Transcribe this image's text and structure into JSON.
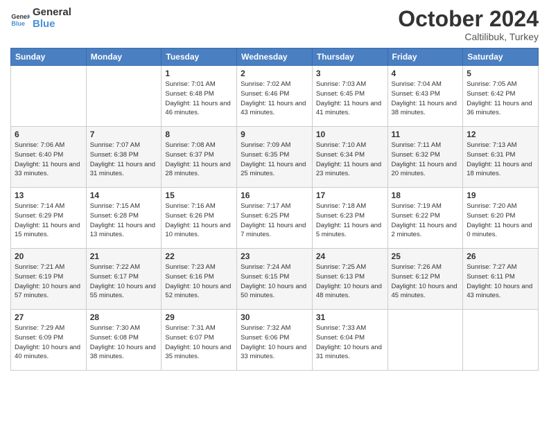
{
  "logo": {
    "line1": "General",
    "line2": "Blue"
  },
  "title": "October 2024",
  "location": "Caltilibuk, Turkey",
  "weekdays": [
    "Sunday",
    "Monday",
    "Tuesday",
    "Wednesday",
    "Thursday",
    "Friday",
    "Saturday"
  ],
  "weeks": [
    [
      {
        "day": "",
        "info": ""
      },
      {
        "day": "",
        "info": ""
      },
      {
        "day": "1",
        "info": "Sunrise: 7:01 AM\nSunset: 6:48 PM\nDaylight: 11 hours and 46 minutes."
      },
      {
        "day": "2",
        "info": "Sunrise: 7:02 AM\nSunset: 6:46 PM\nDaylight: 11 hours and 43 minutes."
      },
      {
        "day": "3",
        "info": "Sunrise: 7:03 AM\nSunset: 6:45 PM\nDaylight: 11 hours and 41 minutes."
      },
      {
        "day": "4",
        "info": "Sunrise: 7:04 AM\nSunset: 6:43 PM\nDaylight: 11 hours and 38 minutes."
      },
      {
        "day": "5",
        "info": "Sunrise: 7:05 AM\nSunset: 6:42 PM\nDaylight: 11 hours and 36 minutes."
      }
    ],
    [
      {
        "day": "6",
        "info": "Sunrise: 7:06 AM\nSunset: 6:40 PM\nDaylight: 11 hours and 33 minutes."
      },
      {
        "day": "7",
        "info": "Sunrise: 7:07 AM\nSunset: 6:38 PM\nDaylight: 11 hours and 31 minutes."
      },
      {
        "day": "8",
        "info": "Sunrise: 7:08 AM\nSunset: 6:37 PM\nDaylight: 11 hours and 28 minutes."
      },
      {
        "day": "9",
        "info": "Sunrise: 7:09 AM\nSunset: 6:35 PM\nDaylight: 11 hours and 25 minutes."
      },
      {
        "day": "10",
        "info": "Sunrise: 7:10 AM\nSunset: 6:34 PM\nDaylight: 11 hours and 23 minutes."
      },
      {
        "day": "11",
        "info": "Sunrise: 7:11 AM\nSunset: 6:32 PM\nDaylight: 11 hours and 20 minutes."
      },
      {
        "day": "12",
        "info": "Sunrise: 7:13 AM\nSunset: 6:31 PM\nDaylight: 11 hours and 18 minutes."
      }
    ],
    [
      {
        "day": "13",
        "info": "Sunrise: 7:14 AM\nSunset: 6:29 PM\nDaylight: 11 hours and 15 minutes."
      },
      {
        "day": "14",
        "info": "Sunrise: 7:15 AM\nSunset: 6:28 PM\nDaylight: 11 hours and 13 minutes."
      },
      {
        "day": "15",
        "info": "Sunrise: 7:16 AM\nSunset: 6:26 PM\nDaylight: 11 hours and 10 minutes."
      },
      {
        "day": "16",
        "info": "Sunrise: 7:17 AM\nSunset: 6:25 PM\nDaylight: 11 hours and 7 minutes."
      },
      {
        "day": "17",
        "info": "Sunrise: 7:18 AM\nSunset: 6:23 PM\nDaylight: 11 hours and 5 minutes."
      },
      {
        "day": "18",
        "info": "Sunrise: 7:19 AM\nSunset: 6:22 PM\nDaylight: 11 hours and 2 minutes."
      },
      {
        "day": "19",
        "info": "Sunrise: 7:20 AM\nSunset: 6:20 PM\nDaylight: 11 hours and 0 minutes."
      }
    ],
    [
      {
        "day": "20",
        "info": "Sunrise: 7:21 AM\nSunset: 6:19 PM\nDaylight: 10 hours and 57 minutes."
      },
      {
        "day": "21",
        "info": "Sunrise: 7:22 AM\nSunset: 6:17 PM\nDaylight: 10 hours and 55 minutes."
      },
      {
        "day": "22",
        "info": "Sunrise: 7:23 AM\nSunset: 6:16 PM\nDaylight: 10 hours and 52 minutes."
      },
      {
        "day": "23",
        "info": "Sunrise: 7:24 AM\nSunset: 6:15 PM\nDaylight: 10 hours and 50 minutes."
      },
      {
        "day": "24",
        "info": "Sunrise: 7:25 AM\nSunset: 6:13 PM\nDaylight: 10 hours and 48 minutes."
      },
      {
        "day": "25",
        "info": "Sunrise: 7:26 AM\nSunset: 6:12 PM\nDaylight: 10 hours and 45 minutes."
      },
      {
        "day": "26",
        "info": "Sunrise: 7:27 AM\nSunset: 6:11 PM\nDaylight: 10 hours and 43 minutes."
      }
    ],
    [
      {
        "day": "27",
        "info": "Sunrise: 7:29 AM\nSunset: 6:09 PM\nDaylight: 10 hours and 40 minutes."
      },
      {
        "day": "28",
        "info": "Sunrise: 7:30 AM\nSunset: 6:08 PM\nDaylight: 10 hours and 38 minutes."
      },
      {
        "day": "29",
        "info": "Sunrise: 7:31 AM\nSunset: 6:07 PM\nDaylight: 10 hours and 35 minutes."
      },
      {
        "day": "30",
        "info": "Sunrise: 7:32 AM\nSunset: 6:06 PM\nDaylight: 10 hours and 33 minutes."
      },
      {
        "day": "31",
        "info": "Sunrise: 7:33 AM\nSunset: 6:04 PM\nDaylight: 10 hours and 31 minutes."
      },
      {
        "day": "",
        "info": ""
      },
      {
        "day": "",
        "info": ""
      }
    ]
  ]
}
